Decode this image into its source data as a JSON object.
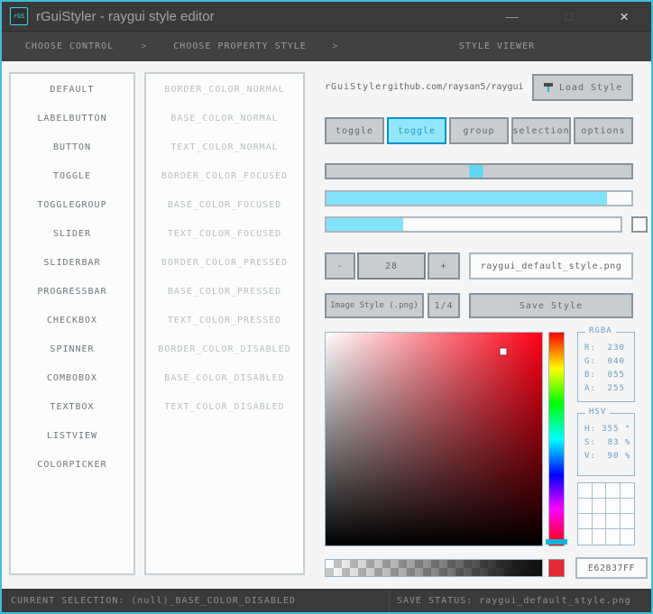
{
  "window": {
    "icon_text": "rGS",
    "title": "rGuiStyler - raygui style editor",
    "minimize_glyph": "—",
    "maximize_glyph": "□",
    "close_glyph": "×"
  },
  "breadcrumb": {
    "items": [
      "CHOOSE CONTROL",
      "CHOOSE PROPERTY STYLE",
      "STYLE VIEWER"
    ],
    "separator": ">"
  },
  "controls": {
    "items": [
      "DEFAULT",
      "LABELBUTTON",
      "BUTTON",
      "TOGGLE",
      "TOGGLEGROUP",
      "SLIDER",
      "SLIDERBAR",
      "PROGRESSBAR",
      "CHECKBOX",
      "SPINNER",
      "COMBOBOX",
      "TEXTBOX",
      "LISTVIEW",
      "COLORPICKER"
    ]
  },
  "properties": {
    "items": [
      "BORDER_COLOR_NORMAL",
      "BASE_COLOR_NORMAL",
      "TEXT_COLOR_NORMAL",
      "BORDER_COLOR_FOCUSED",
      "BASE_COLOR_FOCUSED",
      "TEXT_COLOR_FOCUSED",
      "BORDER_COLOR_PRESSED",
      "BASE_COLOR_PRESSED",
      "TEXT_COLOR_PRESSED",
      "BORDER_COLOR_DISABLED",
      "BASE_COLOR_DISABLED",
      "TEXT_COLOR_DISABLED"
    ]
  },
  "viewer": {
    "app_name": "rGuiStyler",
    "repo_url": "github.com/raysan5/raygui",
    "load_button_label": "Load Style",
    "toggles": [
      "toggle",
      "toggle",
      "group",
      "selection",
      "options"
    ],
    "active_toggle_index": 1,
    "slider": {
      "fraction": 0.49
    },
    "progress": {
      "fraction": 0.92
    },
    "value_bar": {
      "fraction": 0.26
    },
    "spinner": {
      "minus_label": "-",
      "value": "28",
      "plus_label": "+"
    },
    "filename_box": "raygui_default_style.png",
    "image_style_button_label": "Image Style (.png)",
    "fraction_button_label": "1/4",
    "save_button_label": "Save Style",
    "rgba_box": {
      "label": "RGBA",
      "rows": [
        "R:  230",
        "G:  040",
        "B:  055",
        "A:  255"
      ]
    },
    "hsv_box": {
      "label": "HSV",
      "rows": [
        "H: 355 °",
        "S:  83 %",
        "V:  90 %"
      ]
    },
    "hex_value": "E62837FF",
    "picker": {
      "hue_deg": 355,
      "marker_x": 0.82,
      "marker_y": 0.09,
      "hue_frac": 0.985
    },
    "colors": {
      "picked": "#E62837",
      "accent_fill": "#83E3FA",
      "toggle_active_bg": "#91E8FC",
      "toggle_active_border": "#0492C7"
    }
  },
  "statusbar": {
    "left": "CURRENT SELECTION: (null)_BASE_COLOR_DISABLED",
    "right": "SAVE STATUS: raygui_default_style.png"
  }
}
